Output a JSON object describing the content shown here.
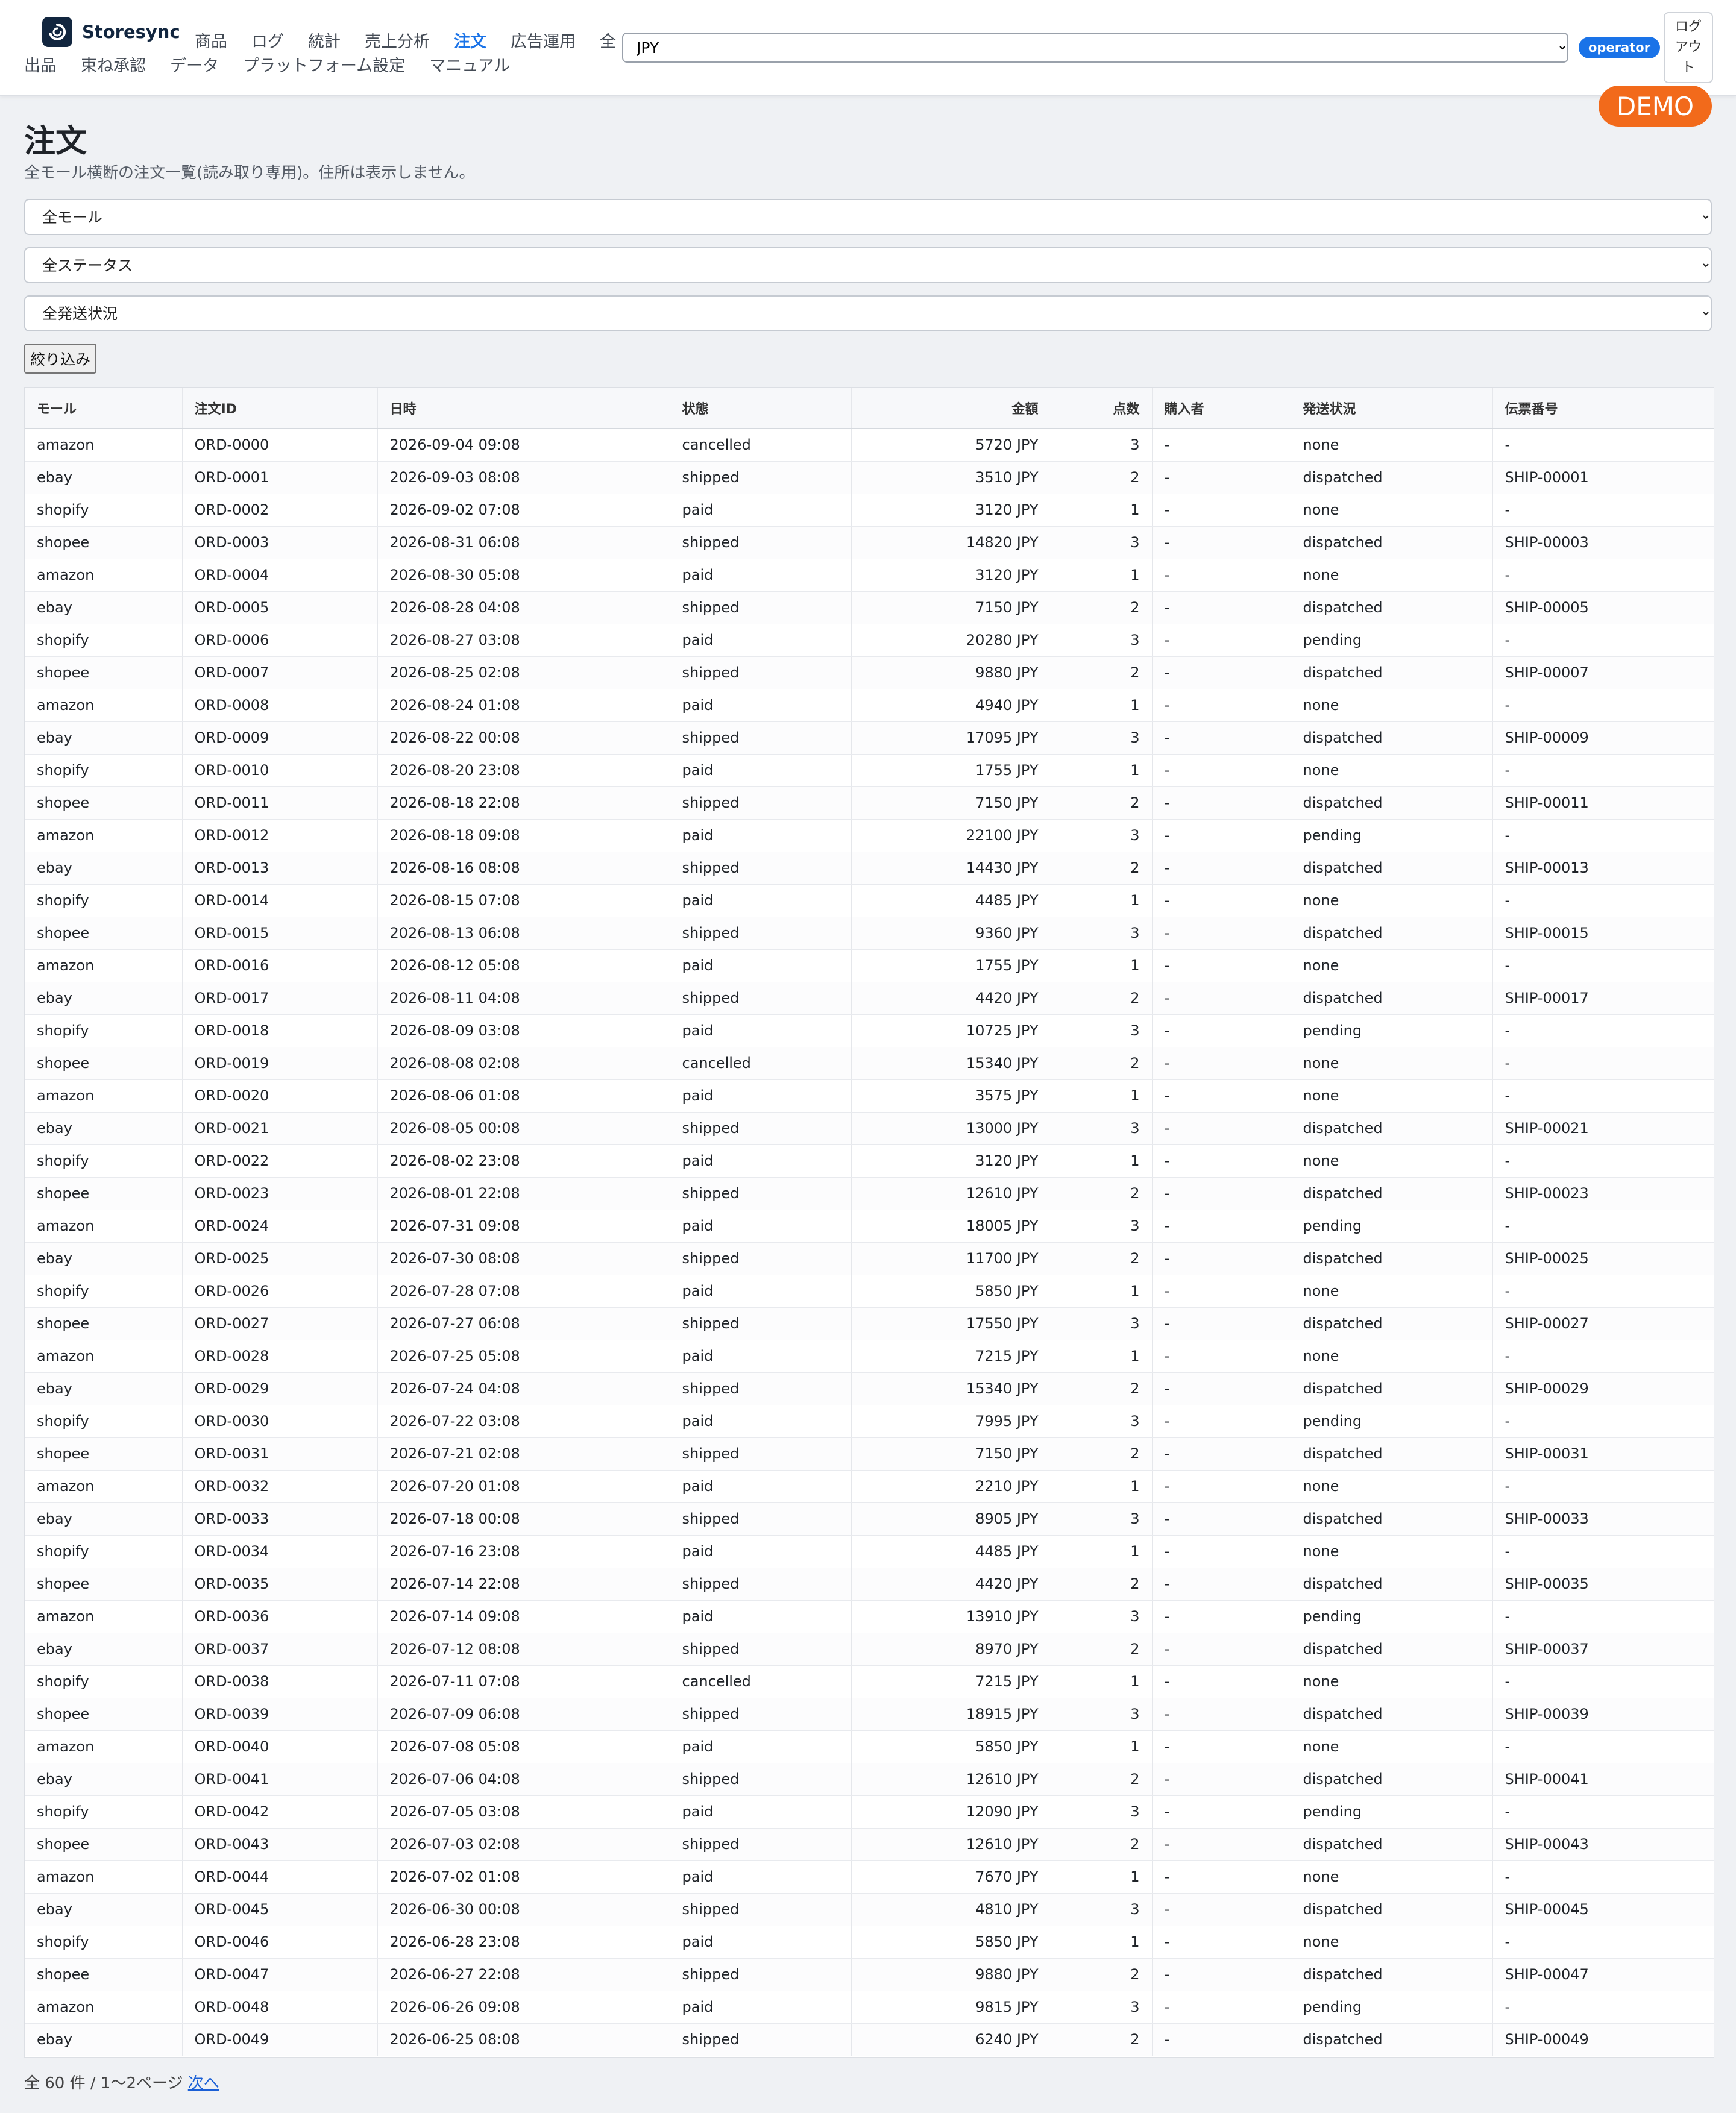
{
  "app": {
    "name": "Storesync",
    "logo_icon": "sync-logo-icon",
    "nav_row1": [
      {
        "label": "商品",
        "active": false
      },
      {
        "label": "ログ",
        "active": false
      },
      {
        "label": "統計",
        "active": false
      },
      {
        "label": "売上分析",
        "active": false
      },
      {
        "label": "注文",
        "active": true
      },
      {
        "label": "広告運用",
        "active": false
      },
      {
        "label": "全",
        "active": false
      }
    ],
    "nav_row2": [
      {
        "label": "出品",
        "active": false
      },
      {
        "label": "束ね承認",
        "active": false
      },
      {
        "label": "データ",
        "active": false
      },
      {
        "label": "プラットフォーム設定",
        "active": false
      },
      {
        "label": "マニュアル",
        "active": false
      }
    ],
    "currency": "JPY",
    "role": "operator",
    "logout_label": "ログアウト",
    "demo_label": "DEMO",
    "accent_color": "#1a73e8",
    "demo_color": "#f26a1b"
  },
  "page": {
    "title": "注文",
    "subtitle": "全モール横断の注文一覧(読み取り専用)。住所は表示しません。"
  },
  "filters": {
    "mall": "全モール",
    "status": "全ステータス",
    "shipping": "全発送状況",
    "apply_label": "絞り込み"
  },
  "table": {
    "columns": [
      "モール",
      "注文ID",
      "日時",
      "状態",
      "金額",
      "点数",
      "購入者",
      "発送状況",
      "伝票番号"
    ],
    "rows": [
      [
        "amazon",
        "ORD-0000",
        "2026-09-04 09:08",
        "cancelled",
        "5720 JPY",
        "3",
        "-",
        "none",
        "-"
      ],
      [
        "ebay",
        "ORD-0001",
        "2026-09-03 08:08",
        "shipped",
        "3510 JPY",
        "2",
        "-",
        "dispatched",
        "SHIP-00001"
      ],
      [
        "shopify",
        "ORD-0002",
        "2026-09-02 07:08",
        "paid",
        "3120 JPY",
        "1",
        "-",
        "none",
        "-"
      ],
      [
        "shopee",
        "ORD-0003",
        "2026-08-31 06:08",
        "shipped",
        "14820 JPY",
        "3",
        "-",
        "dispatched",
        "SHIP-00003"
      ],
      [
        "amazon",
        "ORD-0004",
        "2026-08-30 05:08",
        "paid",
        "3120 JPY",
        "1",
        "-",
        "none",
        "-"
      ],
      [
        "ebay",
        "ORD-0005",
        "2026-08-28 04:08",
        "shipped",
        "7150 JPY",
        "2",
        "-",
        "dispatched",
        "SHIP-00005"
      ],
      [
        "shopify",
        "ORD-0006",
        "2026-08-27 03:08",
        "paid",
        "20280 JPY",
        "3",
        "-",
        "pending",
        "-"
      ],
      [
        "shopee",
        "ORD-0007",
        "2026-08-25 02:08",
        "shipped",
        "9880 JPY",
        "2",
        "-",
        "dispatched",
        "SHIP-00007"
      ],
      [
        "amazon",
        "ORD-0008",
        "2026-08-24 01:08",
        "paid",
        "4940 JPY",
        "1",
        "-",
        "none",
        "-"
      ],
      [
        "ebay",
        "ORD-0009",
        "2026-08-22 00:08",
        "shipped",
        "17095 JPY",
        "3",
        "-",
        "dispatched",
        "SHIP-00009"
      ],
      [
        "shopify",
        "ORD-0010",
        "2026-08-20 23:08",
        "paid",
        "1755 JPY",
        "1",
        "-",
        "none",
        "-"
      ],
      [
        "shopee",
        "ORD-0011",
        "2026-08-18 22:08",
        "shipped",
        "7150 JPY",
        "2",
        "-",
        "dispatched",
        "SHIP-00011"
      ],
      [
        "amazon",
        "ORD-0012",
        "2026-08-18 09:08",
        "paid",
        "22100 JPY",
        "3",
        "-",
        "pending",
        "-"
      ],
      [
        "ebay",
        "ORD-0013",
        "2026-08-16 08:08",
        "shipped",
        "14430 JPY",
        "2",
        "-",
        "dispatched",
        "SHIP-00013"
      ],
      [
        "shopify",
        "ORD-0014",
        "2026-08-15 07:08",
        "paid",
        "4485 JPY",
        "1",
        "-",
        "none",
        "-"
      ],
      [
        "shopee",
        "ORD-0015",
        "2026-08-13 06:08",
        "shipped",
        "9360 JPY",
        "3",
        "-",
        "dispatched",
        "SHIP-00015"
      ],
      [
        "amazon",
        "ORD-0016",
        "2026-08-12 05:08",
        "paid",
        "1755 JPY",
        "1",
        "-",
        "none",
        "-"
      ],
      [
        "ebay",
        "ORD-0017",
        "2026-08-11 04:08",
        "shipped",
        "4420 JPY",
        "2",
        "-",
        "dispatched",
        "SHIP-00017"
      ],
      [
        "shopify",
        "ORD-0018",
        "2026-08-09 03:08",
        "paid",
        "10725 JPY",
        "3",
        "-",
        "pending",
        "-"
      ],
      [
        "shopee",
        "ORD-0019",
        "2026-08-08 02:08",
        "cancelled",
        "15340 JPY",
        "2",
        "-",
        "none",
        "-"
      ],
      [
        "amazon",
        "ORD-0020",
        "2026-08-06 01:08",
        "paid",
        "3575 JPY",
        "1",
        "-",
        "none",
        "-"
      ],
      [
        "ebay",
        "ORD-0021",
        "2026-08-05 00:08",
        "shipped",
        "13000 JPY",
        "3",
        "-",
        "dispatched",
        "SHIP-00021"
      ],
      [
        "shopify",
        "ORD-0022",
        "2026-08-02 23:08",
        "paid",
        "3120 JPY",
        "1",
        "-",
        "none",
        "-"
      ],
      [
        "shopee",
        "ORD-0023",
        "2026-08-01 22:08",
        "shipped",
        "12610 JPY",
        "2",
        "-",
        "dispatched",
        "SHIP-00023"
      ],
      [
        "amazon",
        "ORD-0024",
        "2026-07-31 09:08",
        "paid",
        "18005 JPY",
        "3",
        "-",
        "pending",
        "-"
      ],
      [
        "ebay",
        "ORD-0025",
        "2026-07-30 08:08",
        "shipped",
        "11700 JPY",
        "2",
        "-",
        "dispatched",
        "SHIP-00025"
      ],
      [
        "shopify",
        "ORD-0026",
        "2026-07-28 07:08",
        "paid",
        "5850 JPY",
        "1",
        "-",
        "none",
        "-"
      ],
      [
        "shopee",
        "ORD-0027",
        "2026-07-27 06:08",
        "shipped",
        "17550 JPY",
        "3",
        "-",
        "dispatched",
        "SHIP-00027"
      ],
      [
        "amazon",
        "ORD-0028",
        "2026-07-25 05:08",
        "paid",
        "7215 JPY",
        "1",
        "-",
        "none",
        "-"
      ],
      [
        "ebay",
        "ORD-0029",
        "2026-07-24 04:08",
        "shipped",
        "15340 JPY",
        "2",
        "-",
        "dispatched",
        "SHIP-00029"
      ],
      [
        "shopify",
        "ORD-0030",
        "2026-07-22 03:08",
        "paid",
        "7995 JPY",
        "3",
        "-",
        "pending",
        "-"
      ],
      [
        "shopee",
        "ORD-0031",
        "2026-07-21 02:08",
        "shipped",
        "7150 JPY",
        "2",
        "-",
        "dispatched",
        "SHIP-00031"
      ],
      [
        "amazon",
        "ORD-0032",
        "2026-07-20 01:08",
        "paid",
        "2210 JPY",
        "1",
        "-",
        "none",
        "-"
      ],
      [
        "ebay",
        "ORD-0033",
        "2026-07-18 00:08",
        "shipped",
        "8905 JPY",
        "3",
        "-",
        "dispatched",
        "SHIP-00033"
      ],
      [
        "shopify",
        "ORD-0034",
        "2026-07-16 23:08",
        "paid",
        "4485 JPY",
        "1",
        "-",
        "none",
        "-"
      ],
      [
        "shopee",
        "ORD-0035",
        "2026-07-14 22:08",
        "shipped",
        "4420 JPY",
        "2",
        "-",
        "dispatched",
        "SHIP-00035"
      ],
      [
        "amazon",
        "ORD-0036",
        "2026-07-14 09:08",
        "paid",
        "13910 JPY",
        "3",
        "-",
        "pending",
        "-"
      ],
      [
        "ebay",
        "ORD-0037",
        "2026-07-12 08:08",
        "shipped",
        "8970 JPY",
        "2",
        "-",
        "dispatched",
        "SHIP-00037"
      ],
      [
        "shopify",
        "ORD-0038",
        "2026-07-11 07:08",
        "cancelled",
        "7215 JPY",
        "1",
        "-",
        "none",
        "-"
      ],
      [
        "shopee",
        "ORD-0039",
        "2026-07-09 06:08",
        "shipped",
        "18915 JPY",
        "3",
        "-",
        "dispatched",
        "SHIP-00039"
      ],
      [
        "amazon",
        "ORD-0040",
        "2026-07-08 05:08",
        "paid",
        "5850 JPY",
        "1",
        "-",
        "none",
        "-"
      ],
      [
        "ebay",
        "ORD-0041",
        "2026-07-06 04:08",
        "shipped",
        "12610 JPY",
        "2",
        "-",
        "dispatched",
        "SHIP-00041"
      ],
      [
        "shopify",
        "ORD-0042",
        "2026-07-05 03:08",
        "paid",
        "12090 JPY",
        "3",
        "-",
        "pending",
        "-"
      ],
      [
        "shopee",
        "ORD-0043",
        "2026-07-03 02:08",
        "shipped",
        "12610 JPY",
        "2",
        "-",
        "dispatched",
        "SHIP-00043"
      ],
      [
        "amazon",
        "ORD-0044",
        "2026-07-02 01:08",
        "paid",
        "7670 JPY",
        "1",
        "-",
        "none",
        "-"
      ],
      [
        "ebay",
        "ORD-0045",
        "2026-06-30 00:08",
        "shipped",
        "4810 JPY",
        "3",
        "-",
        "dispatched",
        "SHIP-00045"
      ],
      [
        "shopify",
        "ORD-0046",
        "2026-06-28 23:08",
        "paid",
        "5850 JPY",
        "1",
        "-",
        "none",
        "-"
      ],
      [
        "shopee",
        "ORD-0047",
        "2026-06-27 22:08",
        "shipped",
        "9880 JPY",
        "2",
        "-",
        "dispatched",
        "SHIP-00047"
      ],
      [
        "amazon",
        "ORD-0048",
        "2026-06-26 09:08",
        "paid",
        "9815 JPY",
        "3",
        "-",
        "pending",
        "-"
      ],
      [
        "ebay",
        "ORD-0049",
        "2026-06-25 08:08",
        "shipped",
        "6240 JPY",
        "2",
        "-",
        "dispatched",
        "SHIP-00049"
      ]
    ]
  },
  "pagination": {
    "summary": "全 60 件 / 1〜2ページ",
    "next_label": "次へ"
  }
}
